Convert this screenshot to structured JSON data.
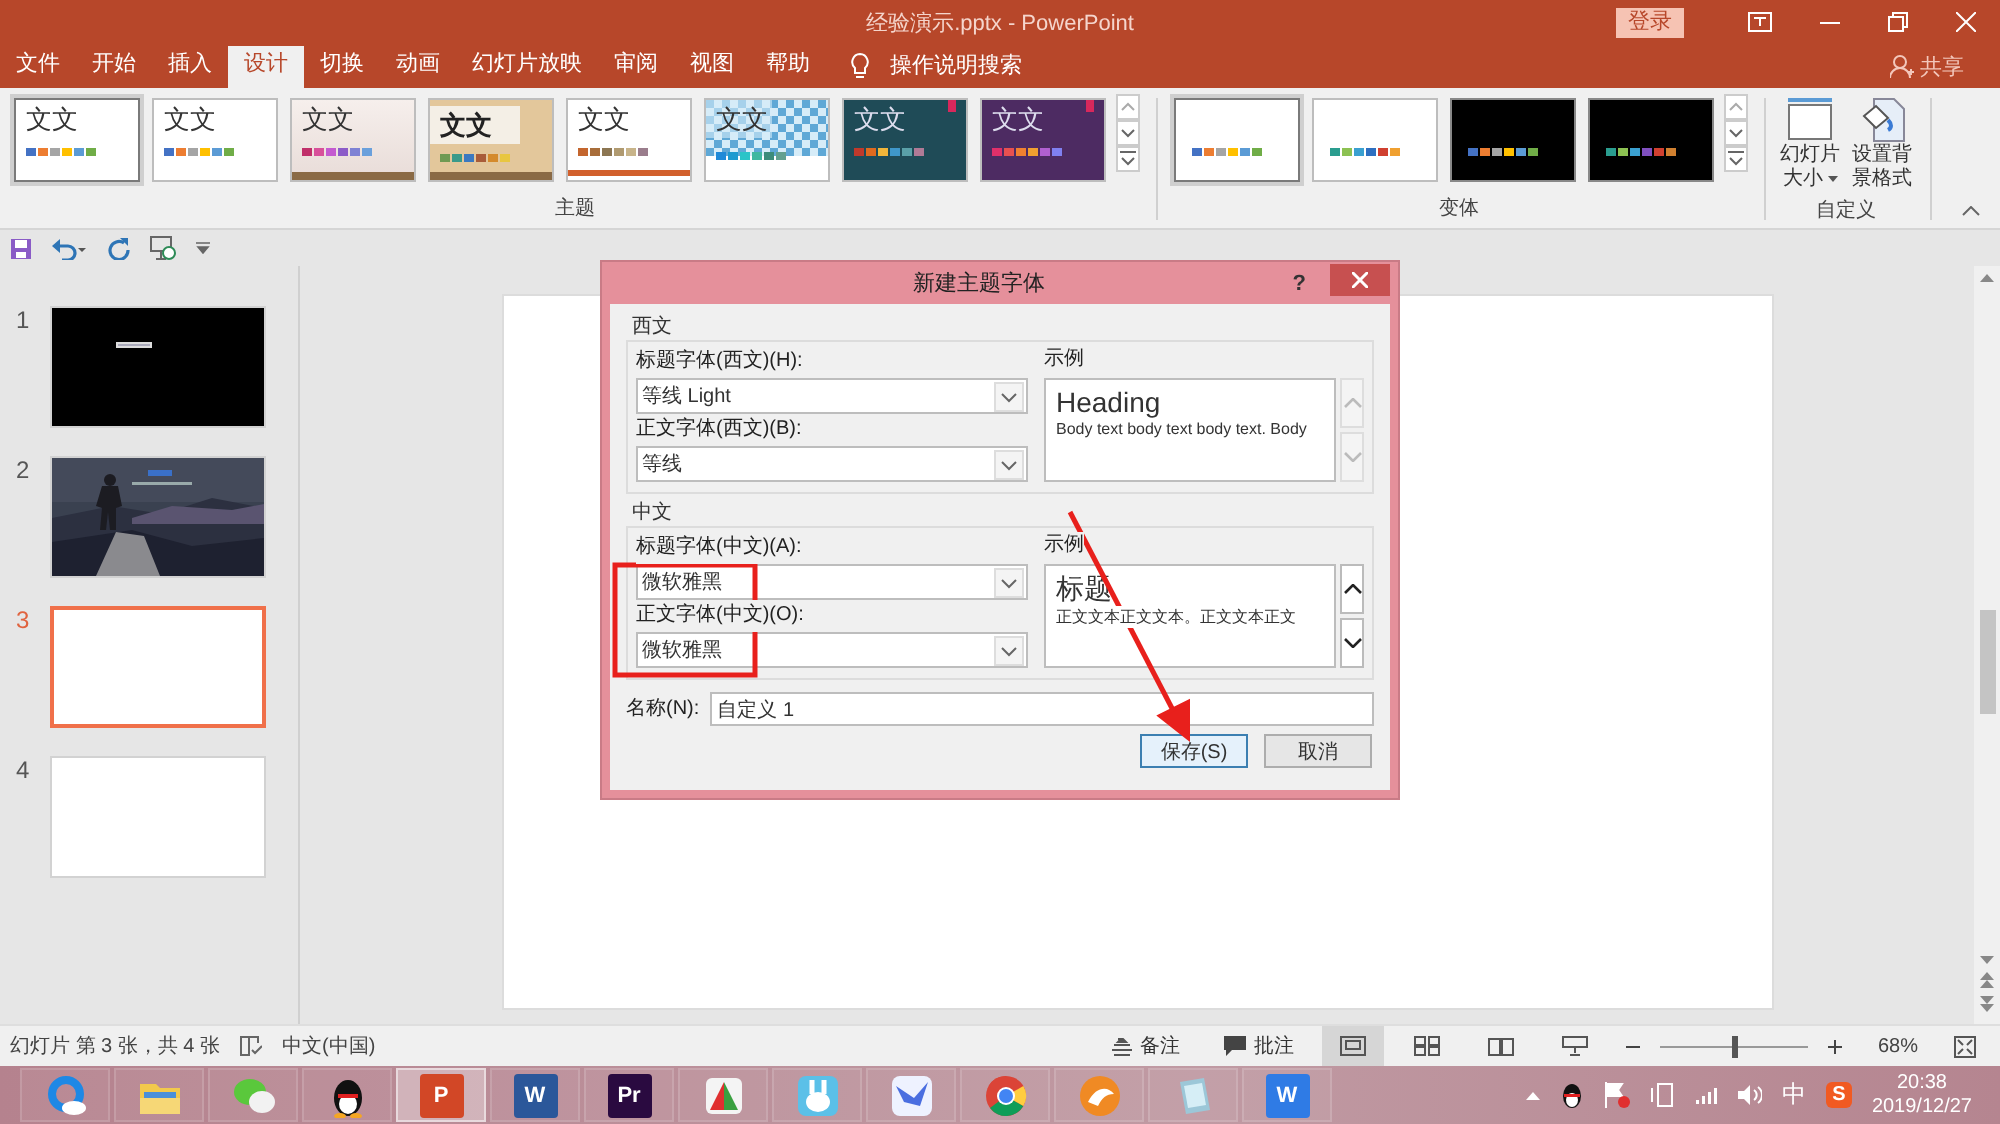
{
  "window": {
    "title": "经验演示.pptx  -  PowerPoint",
    "login": "登录"
  },
  "tabs": [
    {
      "label": "文件",
      "selected": false
    },
    {
      "label": "开始",
      "selected": false
    },
    {
      "label": "插入",
      "selected": false
    },
    {
      "label": "设计",
      "selected": true
    },
    {
      "label": "切换",
      "selected": false
    },
    {
      "label": "动画",
      "selected": false
    },
    {
      "label": "幻灯片放映",
      "selected": false
    },
    {
      "label": "审阅",
      "selected": false
    },
    {
      "label": "视图",
      "selected": false
    },
    {
      "label": "帮助",
      "selected": false
    }
  ],
  "tell_me": "操作说明搜索",
  "share": "共享",
  "themes": {
    "label": "主题",
    "items": [
      {
        "kind": "plain",
        "text": "文文",
        "selected": true,
        "swatches": [
          {
            "color": "#4472c4"
          },
          {
            "color": "#ed7d31"
          },
          {
            "color": "#a5a5a5"
          },
          {
            "color": "#ffc000"
          },
          {
            "color": "#5b9bd5"
          },
          {
            "color": "#70ad47"
          }
        ]
      },
      {
        "kind": "plain",
        "text": "文文",
        "selected": false,
        "swatches": [
          {
            "color": "#4472c4"
          },
          {
            "color": "#ed7d31"
          },
          {
            "color": "#a5a5a5"
          },
          {
            "color": "#ffc000"
          },
          {
            "color": "#5b9bd5"
          },
          {
            "color": "#70ad47"
          }
        ]
      },
      {
        "kind": "paper",
        "text": "文文",
        "selected": false,
        "swatches": [
          {
            "color": "#c0306a"
          },
          {
            "color": "#d8509a"
          },
          {
            "color": "#c45ad0"
          },
          {
            "color": "#8c5cc8"
          },
          {
            "color": "#7e82d4"
          },
          {
            "color": "#6aa0dc"
          }
        ]
      },
      {
        "kind": "wood",
        "text": "文文",
        "selected": false,
        "swatches": [
          {
            "color": "#6f9a53"
          },
          {
            "color": "#3a9a8a"
          },
          {
            "color": "#3c79c0"
          },
          {
            "color": "#a95c39"
          },
          {
            "color": "#d48a2c"
          },
          {
            "color": "#e8c640"
          }
        ]
      },
      {
        "kind": "line",
        "text": "文文",
        "selected": false,
        "swatches": [
          {
            "color": "#c4662e"
          },
          {
            "color": "#a86d3a"
          },
          {
            "color": "#8c7652"
          },
          {
            "color": "#b09a70"
          },
          {
            "color": "#c8b48a"
          },
          {
            "color": "#9a7d8c"
          }
        ]
      },
      {
        "kind": "pattern",
        "text": "文文",
        "selected": false,
        "swatches": [
          {
            "color": "#1f8ad8"
          },
          {
            "color": "#1e9ad0"
          },
          {
            "color": "#2ac4c8"
          },
          {
            "color": "#40b8a0"
          },
          {
            "color": "#3c8c7a"
          },
          {
            "color": "#62a090"
          }
        ]
      },
      {
        "kind": "teal",
        "text": "文文",
        "selected": false,
        "swatches": [
          {
            "color": "#c0392b"
          },
          {
            "color": "#e06a1e"
          },
          {
            "color": "#f2b63a"
          },
          {
            "color": "#3f97c9"
          },
          {
            "color": "#5aa0a8"
          },
          {
            "color": "#b07a96"
          }
        ]
      },
      {
        "kind": "purple",
        "text": "文文",
        "selected": false,
        "swatches": [
          {
            "color": "#e0306a"
          },
          {
            "color": "#e85050"
          },
          {
            "color": "#f08030"
          },
          {
            "color": "#f0a030"
          },
          {
            "color": "#b060d0"
          },
          {
            "color": "#8080f0"
          }
        ]
      }
    ]
  },
  "variants": {
    "label": "变体",
    "items": [
      {
        "kind": "light",
        "selected": true,
        "swatches": [
          {
            "color": "#4472c4"
          },
          {
            "color": "#ed7d31"
          },
          {
            "color": "#a5a5a5"
          },
          {
            "color": "#ffc000"
          },
          {
            "color": "#5b9bd5"
          },
          {
            "color": "#70ad47"
          }
        ]
      },
      {
        "kind": "light",
        "selected": false,
        "swatches": [
          {
            "color": "#2a9d8f"
          },
          {
            "color": "#8cc152"
          },
          {
            "color": "#3aa0d0"
          },
          {
            "color": "#2e6fc0"
          },
          {
            "color": "#d04030"
          },
          {
            "color": "#f0a030"
          }
        ]
      },
      {
        "kind": "dark",
        "selected": false,
        "swatches": [
          {
            "color": "#4472c4"
          },
          {
            "color": "#ed7d31"
          },
          {
            "color": "#a5a5a5"
          },
          {
            "color": "#ffc000"
          },
          {
            "color": "#5b9bd5"
          },
          {
            "color": "#70ad47"
          }
        ]
      },
      {
        "kind": "dark",
        "selected": false,
        "swatches": [
          {
            "color": "#2a9d8f"
          },
          {
            "color": "#8cc152"
          },
          {
            "color": "#3aa0d0"
          },
          {
            "color": "#8050c0"
          },
          {
            "color": "#d04030"
          },
          {
            "color": "#d08030"
          }
        ]
      }
    ]
  },
  "customize": {
    "label": "自定义",
    "buttons": [
      {
        "kind": "size",
        "lines": [
          "幻灯片",
          "大小"
        ],
        "dropdown": true
      },
      {
        "kind": "format",
        "lines": [
          "设置背",
          "景格式"
        ],
        "dropdown": false
      }
    ]
  },
  "slides": [
    {
      "number": "1",
      "kind": "dark",
      "selected": false
    },
    {
      "number": "2",
      "selected": false
    },
    {
      "number": "3",
      "kind": "blank",
      "selected": true
    },
    {
      "number": "4",
      "kind": "blank",
      "selected": false
    }
  ],
  "dialog": {
    "title": "新建主题字体",
    "help": "?",
    "sections": [
      {
        "label": "西文",
        "heading_label": "标题字体(西文)(H):",
        "heading_value": "等线 Light",
        "body_label": "正文字体(西文)(B):",
        "body_value": "等线",
        "sample_label": "示例",
        "sample_heading": "Heading",
        "sample_body": "Body text body text body text. Body",
        "scroll_enabled": false
      },
      {
        "label": "中文",
        "heading_label": "标题字体(中文)(A):",
        "heading_value": "微软雅黑",
        "body_label": "正文字体(中文)(O):",
        "body_value": "微软雅黑",
        "sample_label": "示例",
        "sample_heading": "标题",
        "sample_body": "正文文本正文文本。正文文本正文",
        "scroll_enabled": true
      }
    ],
    "name_label": "名称(N):",
    "name_value": "自定义 1",
    "buttons": [
      {
        "label": "保存(S)",
        "default": true
      },
      {
        "label": "取消",
        "default": false
      }
    ]
  },
  "status_bar": {
    "slide_info": "幻灯片 第 3 张，共 4 张",
    "language": "中文(中国)",
    "notes": "备注",
    "comments": "批注",
    "views": [
      {
        "kind": "normal",
        "selected": true
      },
      {
        "kind": "sorter",
        "selected": false
      },
      {
        "kind": "reading",
        "selected": false
      },
      {
        "kind": "show",
        "selected": false
      }
    ],
    "zoom_slider": {
      "level": 0.5
    },
    "zoom": "68%"
  },
  "taskbar": {
    "apps": [
      {
        "kind": "ring",
        "active": false
      },
      {
        "kind": "folder",
        "active": false
      },
      {
        "kind": "chat",
        "active": false
      },
      {
        "kind": "penguin",
        "active": false
      },
      {
        "kind": "letter",
        "label": "P",
        "color": "#d24726",
        "active": true
      },
      {
        "kind": "letter",
        "label": "W",
        "color": "#2b579a",
        "active": false
      },
      {
        "kind": "letter",
        "label": "Pr",
        "color": "#2a0a40",
        "active": false
      },
      {
        "kind": "fan",
        "active": false
      },
      {
        "kind": "rabbit",
        "active": false
      },
      {
        "kind": "bird",
        "active": false
      },
      {
        "kind": "globe",
        "active": false
      },
      {
        "kind": "fox",
        "active": false
      },
      {
        "kind": "notepad",
        "active": false
      },
      {
        "kind": "letter",
        "label": "W",
        "color": "#2f7be5",
        "active": false
      }
    ],
    "tray": {
      "ime": "中",
      "sogou": "S",
      "time": "20:38",
      "date": "2019/12/27"
    }
  }
}
